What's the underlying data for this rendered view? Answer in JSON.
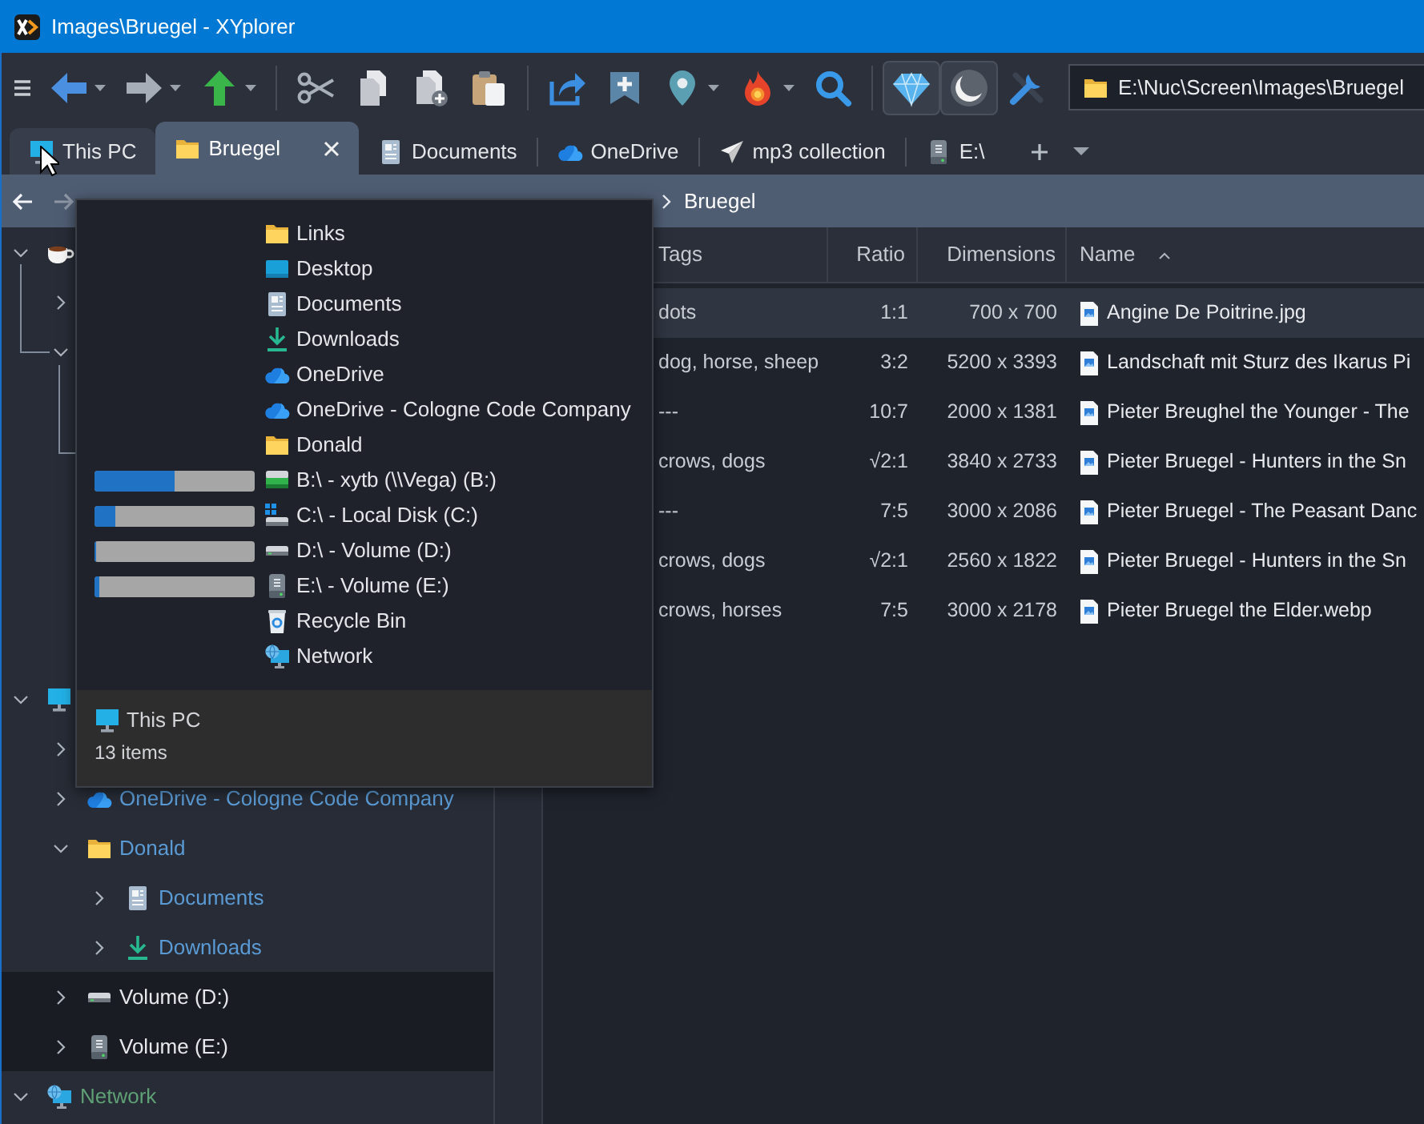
{
  "window": {
    "title": "Images\\Bruegel - XYplorer"
  },
  "toolbar": {
    "groups": [
      [
        {
          "kind": "menu",
          "on": false,
          "dropdown": false
        },
        {
          "kind": "back",
          "on": false,
          "dropdown": true
        },
        {
          "kind": "forward",
          "on": false,
          "dropdown": true
        },
        {
          "kind": "up",
          "on": false,
          "dropdown": true
        }
      ],
      [
        {
          "kind": "cut",
          "on": false,
          "dropdown": false
        },
        {
          "kind": "copy",
          "on": false,
          "dropdown": false
        },
        {
          "kind": "copy-to",
          "on": false,
          "dropdown": false
        },
        {
          "kind": "paste",
          "on": false,
          "dropdown": false
        }
      ],
      [
        {
          "kind": "share",
          "on": false,
          "dropdown": false
        },
        {
          "kind": "bookmark",
          "on": false,
          "dropdown": false
        },
        {
          "kind": "pin",
          "on": false,
          "dropdown": true
        },
        {
          "kind": "fire",
          "on": false,
          "dropdown": true
        },
        {
          "kind": "search",
          "on": false,
          "dropdown": false
        }
      ],
      [
        {
          "kind": "diamond",
          "on": true,
          "dropdown": false
        },
        {
          "kind": "moon",
          "on": true,
          "dropdown": false
        },
        {
          "kind": "tools",
          "on": false,
          "dropdown": false
        }
      ]
    ]
  },
  "address": {
    "value": "E:\\Nuc\\Screen\\Images\\Bruegel"
  },
  "tabs": [
    {
      "kind": "computer",
      "label": "This PC",
      "selected": false,
      "hovered": true
    },
    {
      "kind": "folder",
      "label": "Bruegel",
      "selected": true,
      "hovered": false
    },
    {
      "kind": "document",
      "label": "Documents",
      "selected": false,
      "hovered": false
    },
    {
      "kind": "cloud",
      "label": "OneDrive",
      "selected": false,
      "hovered": false
    },
    {
      "kind": "send",
      "label": "mp3 collection",
      "selected": false,
      "hovered": false
    },
    {
      "kind": "drive-e",
      "label": "E:\\",
      "selected": false,
      "hovered": false
    }
  ],
  "nav_bar": {
    "buttons": [
      {
        "kind": "back",
        "disabled": false
      },
      {
        "kind": "forward",
        "disabled": true
      }
    ],
    "crumbs": [
      "Bruegel"
    ]
  },
  "tree": [
    {
      "kind": "cup",
      "expanded": true,
      "highlighted": false,
      "children": [
        {
          "expanded": false,
          "highlighted": false
        },
        {
          "expanded": true,
          "highlighted": false
        }
      ]
    },
    {
      "kind": "computer",
      "expanded": true,
      "highlighted": false,
      "children": [
        {
          "expanded": false,
          "highlighted": false
        },
        {
          "kind": "cloud",
          "label": "OneDrive - Cologne Code Company",
          "color": "#5b9bd5",
          "expanded": false,
          "highlighted": false
        },
        {
          "kind": "folder",
          "label": "Donald",
          "color": "#5b9bd5",
          "expanded": true,
          "highlighted": false,
          "children": [
            {
              "kind": "document",
              "label": "Documents",
              "color": "#5b9bd5",
              "expanded": false,
              "highlighted": false
            },
            {
              "kind": "download",
              "label": "Downloads",
              "color": "#5b9bd5",
              "expanded": false,
              "highlighted": false
            }
          ]
        },
        {
          "kind": "drive",
          "label": "Volume (D:)",
          "color": "#e6e8eb",
          "expanded": false,
          "highlighted": true
        },
        {
          "kind": "drive-e",
          "label": "Volume (E:)",
          "color": "#e6e8eb",
          "expanded": false,
          "highlighted": true
        }
      ]
    },
    {
      "kind": "network",
      "label": "Network",
      "color": "#5fa075",
      "expanded": true,
      "highlighted": false
    }
  ],
  "file_list": {
    "columns": [
      {
        "label": "Tags",
        "sorted": false
      },
      {
        "label": "Ratio",
        "sorted": false
      },
      {
        "label": "Dimensions",
        "sorted": false
      },
      {
        "label": "Name",
        "sorted": true
      }
    ],
    "rows": [
      {
        "selected": true,
        "cells": [
          "dots",
          "1:1",
          "700 x 700",
          "Angine De Poitrine.jpg"
        ]
      },
      {
        "selected": false,
        "cells": [
          "dog, horse, sheep",
          "3:2",
          "5200 x 3393",
          "Landschaft mit Sturz des Ikarus Pi"
        ]
      },
      {
        "selected": false,
        "cells": [
          "---",
          "10:7",
          "2000 x 1381",
          "Pieter Breughel the Younger - The"
        ]
      },
      {
        "selected": false,
        "cells": [
          "crows, dogs",
          "√2:1",
          "3840 x 2733",
          "Pieter Bruegel - Hunters in the Sn"
        ]
      },
      {
        "selected": false,
        "cells": [
          "---",
          "7:5",
          "3000 x 2086",
          "Pieter Bruegel - The Peasant Danc"
        ]
      },
      {
        "selected": false,
        "cells": [
          "crows, dogs",
          "√2:1",
          "2560 x 1822",
          "Pieter Bruegel - Hunters in the Sn"
        ]
      },
      {
        "selected": false,
        "cells": [
          "crows, horses",
          "7:5",
          "3000 x 2178",
          "Pieter Bruegel the Elder.webp"
        ]
      }
    ]
  },
  "popup": {
    "items": [
      {
        "kind": "folder",
        "label": "Links"
      },
      {
        "kind": "desktop",
        "label": "Desktop"
      },
      {
        "kind": "document",
        "label": "Documents"
      },
      {
        "kind": "download",
        "label": "Downloads"
      },
      {
        "kind": "cloud",
        "label": "OneDrive"
      },
      {
        "kind": "cloud",
        "label": "OneDrive - Cologne Code Company"
      },
      {
        "kind": "folder",
        "label": "Donald"
      },
      {
        "kind": "network-drive",
        "label": "B:\\ - xytb (\\\\Vega) (B:)",
        "level": 0.5
      },
      {
        "kind": "system-drive",
        "label": "C:\\ - Local Disk (C:)",
        "level": 0.13
      },
      {
        "kind": "drive",
        "label": "D:\\ - Volume (D:)",
        "level": 0.01
      },
      {
        "kind": "drive-e",
        "label": "E:\\ - Volume (E:)",
        "level": 0.03
      },
      {
        "kind": "recycle-bin",
        "label": "Recycle Bin"
      },
      {
        "kind": "network",
        "label": "Network"
      }
    ],
    "footer": {
      "kind": "computer",
      "title": "This PC",
      "count": "13 items"
    }
  }
}
